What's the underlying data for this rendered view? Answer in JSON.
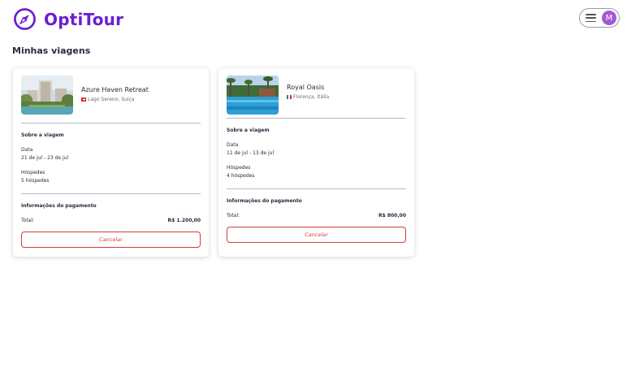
{
  "app": {
    "name": "OptiTour",
    "brand_color": "#6a1fd0"
  },
  "header": {
    "menu_icon": "hamburger-icon",
    "avatar_initial": "M"
  },
  "page": {
    "title": "Minhas viagens"
  },
  "trips": [
    {
      "hotel_name": "Azure Haven Retreat",
      "location": "Lago Sereno, Suiça",
      "flag": "switzerland-flag-icon",
      "about_title": "Sobre a viagem",
      "date_label": "Data",
      "date_value": "21 de jul - 23 de jul",
      "guests_label": "Hóspedes",
      "guests_value": "5 hóspedes",
      "payment_title": "Informações do pagamento",
      "total_label": "Total:",
      "total_value": "R$ 1.200,00",
      "cancel_label": "Cancelar"
    },
    {
      "hotel_name": "Royal Oasis",
      "location": "Florença, Itália",
      "flag": "italy-flag-icon",
      "about_title": "Sobre a viagem",
      "date_label": "Data",
      "date_value": "11 de jul - 13 de jul",
      "guests_label": "Hóspedes",
      "guests_value": "4 hóspedes",
      "payment_title": "Informações do pagamento",
      "total_label": "Total:",
      "total_value": "R$ 800,00",
      "cancel_label": "Cancelar"
    }
  ]
}
